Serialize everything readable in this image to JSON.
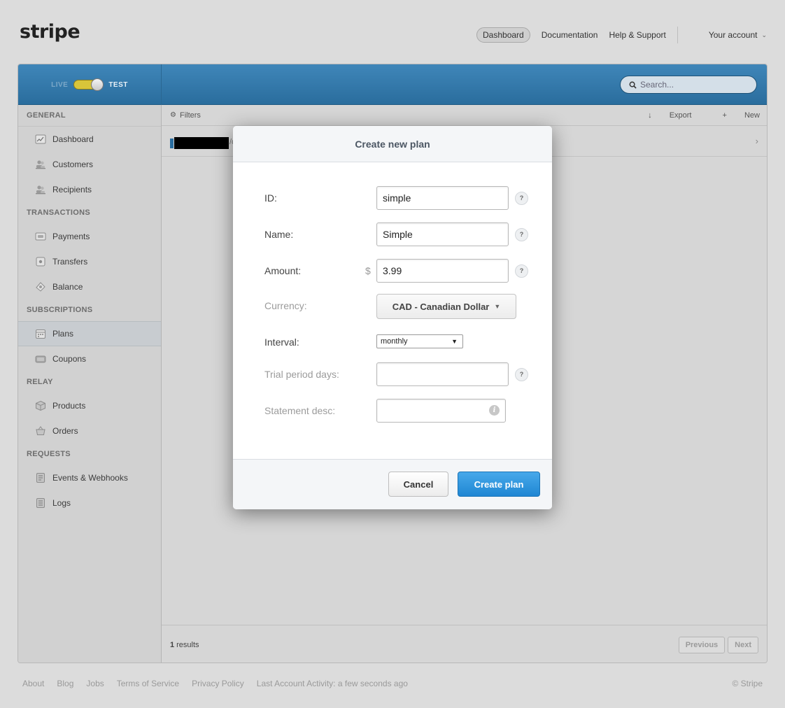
{
  "header": {
    "logo": "stripe",
    "nav": {
      "dashboard": "Dashboard",
      "documentation": "Documentation",
      "help": "Help & Support",
      "account": "Your account"
    }
  },
  "mode_toggle": {
    "live": "LIVE",
    "test": "TEST"
  },
  "search": {
    "placeholder": "Search..."
  },
  "sidebar": {
    "sections": [
      {
        "title": "GENERAL",
        "items": [
          {
            "label": "Dashboard",
            "icon": "dashboard-icon"
          },
          {
            "label": "Customers",
            "icon": "customers-icon"
          },
          {
            "label": "Recipients",
            "icon": "recipients-icon"
          }
        ]
      },
      {
        "title": "TRANSACTIONS",
        "items": [
          {
            "label": "Payments",
            "icon": "payments-icon"
          },
          {
            "label": "Transfers",
            "icon": "transfers-icon"
          },
          {
            "label": "Balance",
            "icon": "balance-icon"
          }
        ]
      },
      {
        "title": "SUBSCRIPTIONS",
        "items": [
          {
            "label": "Plans",
            "icon": "plans-icon",
            "active": true
          },
          {
            "label": "Coupons",
            "icon": "coupons-icon"
          }
        ]
      },
      {
        "title": "RELAY",
        "items": [
          {
            "label": "Products",
            "icon": "products-icon"
          },
          {
            "label": "Orders",
            "icon": "orders-icon"
          }
        ]
      },
      {
        "title": "REQUESTS",
        "items": [
          {
            "label": "Events & Webhooks",
            "icon": "events-icon"
          },
          {
            "label": "Logs",
            "icon": "logs-icon"
          }
        ]
      }
    ]
  },
  "toolbar": {
    "filters": "Filters",
    "export": "Export",
    "new": "New"
  },
  "list": {
    "row_suffix": "/c"
  },
  "pagination": {
    "count": "1",
    "results_label": "results",
    "previous": "Previous",
    "next": "Next"
  },
  "footer": {
    "links": [
      "About",
      "Blog",
      "Jobs",
      "Terms of Service",
      "Privacy Policy"
    ],
    "activity": "Last Account Activity: a few seconds ago",
    "copyright": "© Stripe"
  },
  "modal": {
    "title": "Create new plan",
    "fields": {
      "id": {
        "label": "ID:",
        "value": "simple"
      },
      "name": {
        "label": "Name:",
        "value": "Simple"
      },
      "amount": {
        "label": "Amount:",
        "prefix": "$",
        "value": "3.99"
      },
      "currency": {
        "label": "Currency:",
        "value": "CAD - Canadian Dollar"
      },
      "interval": {
        "label": "Interval:",
        "value": "monthly"
      },
      "trial": {
        "label": "Trial period days:",
        "value": ""
      },
      "statement": {
        "label": "Statement desc:",
        "value": ""
      }
    },
    "help_glyph": "?",
    "info_glyph": "i",
    "cancel": "Cancel",
    "submit": "Create plan"
  },
  "colors": {
    "header_blue": "#2f78ab",
    "primary_button": "#2a8fd9",
    "toggle_yellow": "#d8c53a"
  }
}
